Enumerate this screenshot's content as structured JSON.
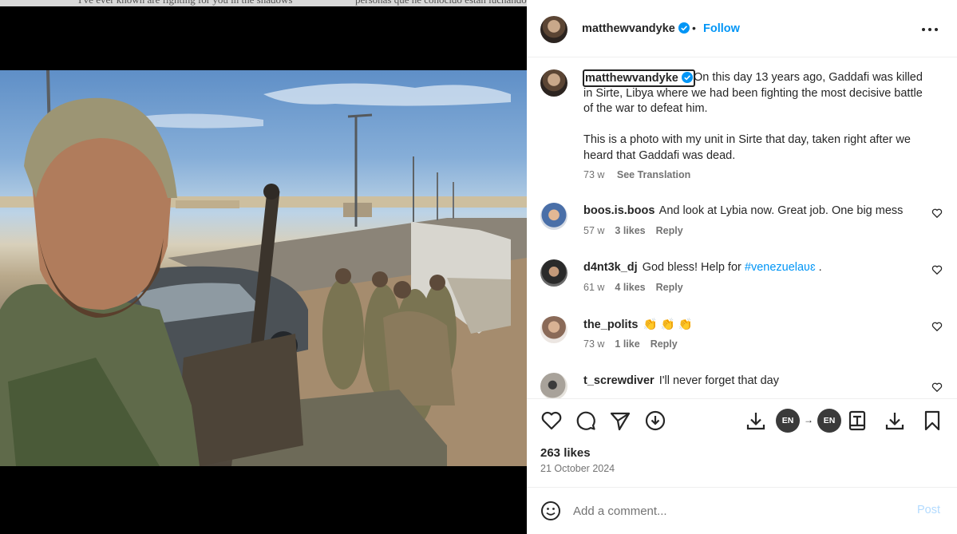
{
  "media": {
    "top_strip_left": "I've ever known are fighting for you in the shadows",
    "top_strip_right": "personas que he conocido están luchando por ti en las"
  },
  "post": {
    "author": "matthewvandyke",
    "follow_label": "Follow",
    "separator": "•",
    "caption_user": "matthewvandyke",
    "caption_p1": "On this day 13 years ago, Gaddafi was killed in Sirte, Libya where we had been fighting the most decisive battle of the war to defeat him.",
    "caption_p2": "This is a photo with my unit in Sirte that day, taken right after we heard that Gaddafi was dead.",
    "caption_age": "73 w",
    "see_translation": "See Translation",
    "likes": "263 likes",
    "date": "21 October 2024",
    "translate_from": "EN",
    "translate_to": "EN"
  },
  "comments": [
    {
      "user": "boos.is.boos",
      "text": "And look at Lybia now. Great job. One big mess",
      "age": "57 w",
      "likes": "3 likes",
      "reply": "Reply"
    },
    {
      "user": "d4nt3k_dj",
      "text": "God bless! Help for ",
      "hashtag": "#venezuelaʋɛ",
      "after": " .",
      "age": "61 w",
      "likes": "4 likes",
      "reply": "Reply"
    },
    {
      "user": "the_polits",
      "text": "👏 👏 👏",
      "age": "73 w",
      "likes": "1 like",
      "reply": "Reply"
    },
    {
      "user": "t_screwdiver",
      "text": "I'll never forget that day"
    }
  ],
  "add_comment": {
    "placeholder": "Add a comment...",
    "post_label": "Post"
  },
  "colors": {
    "accent": "#0095f6",
    "text": "#262626",
    "muted": "#737373"
  },
  "icons": [
    "more-icon",
    "verified-icon",
    "heart-icon",
    "comment-icon",
    "share-icon",
    "download-icon",
    "translate-icon",
    "bookmark-icon",
    "emoji-icon"
  ]
}
